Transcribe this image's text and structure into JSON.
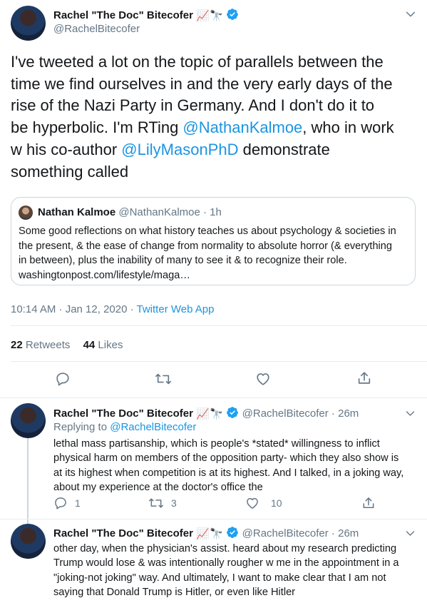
{
  "main_tweet": {
    "author_name": "Rachel \"The Doc\" Bitecofer",
    "author_emoji": "📈🔭",
    "handle": "@RachelBitecofer",
    "text_lines": [
      "I've tweeted a lot on the topic of parallels between the",
      "time we find ourselves in and the very early days of the",
      "rise of the Nazi Party in Germany. And I don't do it to"
    ],
    "text_line4_pre": "be hyperbolic. I'm RTing ",
    "mention1": "@NathanKalmoe",
    "text_line4_post": ", who in work",
    "text_line5_pre": "w his co-author ",
    "mention2": "@LilyMasonPhD",
    "text_line5_post": " demonstrate",
    "text_line6": "something called",
    "quote": {
      "author_name": "Nathan Kalmoe",
      "handle_time": "@NathanKalmoe · 1h",
      "lines": [
        "Some good reflections on what history teaches us about psychology & societies in",
        "the present, & the ease of change from normality to absolute horror (& everything",
        "in between), plus the inability of many to see it & to recognize their role.",
        "washingtonpost.com/lifestyle/maga…"
      ]
    },
    "timestamp": "10:14 AM · Jan 12, 2020",
    "separator": " · ",
    "source": "Twitter Web App",
    "retweets_count": "22",
    "retweets_label": "Retweets",
    "likes_count": "44",
    "likes_label": "Likes"
  },
  "reply1": {
    "author_name": "Rachel \"The Doc\" Bitecofer",
    "author_emoji": "📈🔭",
    "handle_time": "@RachelBitecofer · 26m",
    "replying_to_label": "Replying to ",
    "replying_to_handle": "@RachelBitecofer",
    "lines": [
      "lethal mass partisanship, which is people's *stated* willingness to inflict",
      "physical harm on members of the opposition party- which they also show is",
      "at its highest when competition is at its highest. And I talked, in a joking way,",
      "about my experience at the doctor's office the"
    ],
    "reply_count": "1",
    "retweet_count": "3",
    "like_count": "10"
  },
  "reply2": {
    "author_name": "Rachel \"The Doc\" Bitecofer",
    "author_emoji": "📈🔭",
    "handle_time": "@RachelBitecofer · 26m",
    "lines": [
      "other day, when the physician's assist. heard about my research predicting",
      "Trump would lose & was intentionally rougher w me in the appointment in a",
      "\"joking-not joking\" way. And ultimately, I want to make clear that I am not",
      "saying that Donald Trump is Hitler, or even like Hitler"
    ]
  },
  "colors": {
    "link": "#1b95e0",
    "muted": "#657786",
    "divider": "#e6ecf0",
    "verified": "#1da1f2"
  },
  "icons": [
    "verified-badge-icon",
    "chevron-down-icon",
    "reply-icon",
    "retweet-icon",
    "like-icon",
    "share-icon"
  ]
}
